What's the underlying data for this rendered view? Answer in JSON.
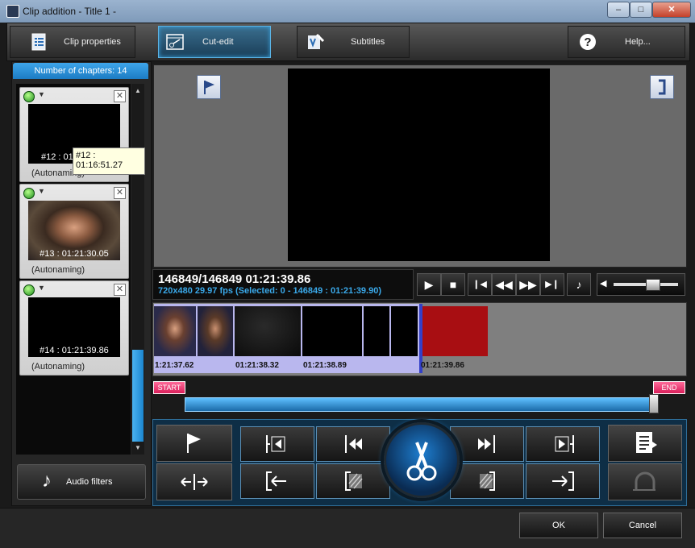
{
  "window": {
    "title": "Clip addition - Title 1 -",
    "min": "–",
    "max": "□",
    "close": "✕"
  },
  "toolbar": {
    "clip_properties": "Clip properties",
    "cut_edit": "Cut-edit",
    "subtitles": "Subtitles",
    "help": "Help..."
  },
  "chapters": {
    "header": "Number of chapters: 14",
    "items": [
      {
        "timecode": "#12 : 01",
        "name": "(Autonaming)"
      },
      {
        "timecode": "#13 : 01:21:30.05",
        "name": "(Autonaming)"
      },
      {
        "timecode": "#14 : 01:21:39.86",
        "name": "(Autonaming)"
      }
    ],
    "tooltip": "#12 : 01:16:51.27"
  },
  "audio_filters": "Audio filters",
  "info": {
    "frames": "146849/146849  01:21:39.86",
    "details": "720x480 29.97  fps  (Selected: 0 - 146849 : 01:21:39.90)"
  },
  "timeline": {
    "timecodes": [
      "1:21:37.62",
      "01:21:38.32",
      "01:21:38.89",
      "01:21:39.86"
    ],
    "start": "START",
    "end": "END"
  },
  "footer": {
    "ok": "OK",
    "cancel": "Cancel"
  },
  "colors": {
    "accent": "#2a9ee8",
    "selection": "#b9b7ee",
    "red_clip": "#a80e12"
  }
}
